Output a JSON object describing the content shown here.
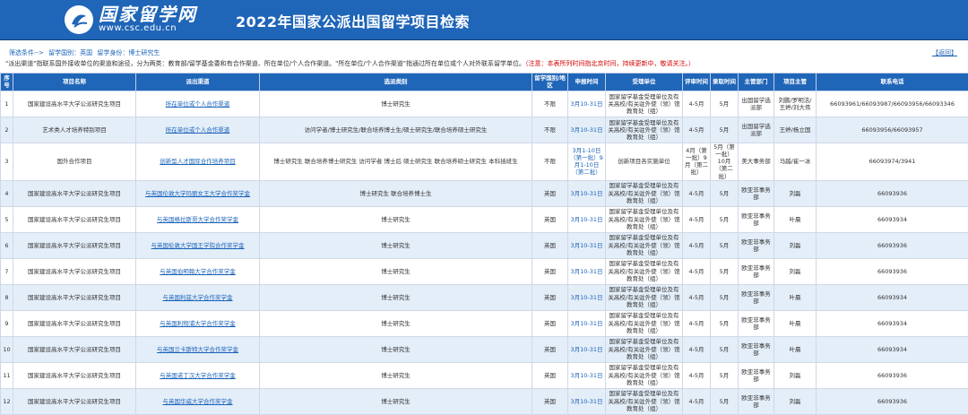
{
  "header": {
    "logo_title": "国家留学网",
    "logo_url": "www.csc.edu.cn",
    "page_title": "2022年国家公派出国留学项目检索"
  },
  "filter": {
    "label": "筛选条件-->",
    "country": "留学国别：英国",
    "identity": "留学身份：博士研究生",
    "back_label": "【返回】"
  },
  "note": {
    "text": "\"派出渠道\"指联系国外接收单位的渠道和途径，分为两类：教育部/留学基金委和有合作渠道、所在单位/个人合作渠道。\"所在单位/个人合作渠道\"指通过所在单位或个人对外联系留学单位。",
    "warning": "（注意：本表所列时间指北京时间，持续更新中，敬请关注。）"
  },
  "table": {
    "headers": [
      "序号",
      "项目名称",
      "派出渠道",
      "选派类别",
      "留学国别/地区",
      "申报时间",
      "受理单位",
      "评审时间",
      "录取时间",
      "主管部门",
      "项目主管",
      "联系电话"
    ],
    "rows": [
      {
        "no": "1",
        "name": "国家建设高水平大学公派研究生项目",
        "channel": "所在单位或个人合作渠道",
        "category": "博士研究生",
        "country": "不限",
        "apply": "3月10-31日",
        "accept": "国家留学基金受理单位及有关高校/有关驻外使（领）馆教育处（组）",
        "review": "4-5月",
        "admit": "5月",
        "dept": "出国留学选派部",
        "manager": "刘鹏/罗明洁/王婷/刘大伟",
        "phone": "66093961/66093987/66093956/66093346"
      },
      {
        "no": "2",
        "name": "艺术类人才培养特别项目",
        "channel": "所在单位或个人合作渠道",
        "category": "访问学者/博士研究生/联合培养博士生/硕士研究生/联合培养硕士研究生",
        "country": "不限",
        "apply": "3月10-31日",
        "accept": "国家留学基金受理单位及有关高校/有关驻外使（领）馆教育处（组）",
        "review": "4-5月",
        "admit": "5月",
        "dept": "出国留学选派部",
        "manager": "王婷/杨立国",
        "phone": "66093956/66093957"
      },
      {
        "no": "3",
        "name": "国外合作项目",
        "channel": "创新型人才国际合作培养项目",
        "category": "博士研究生 联合培养博士研究生 访问学者 博士后 硕士研究生 联合培养硕士研究生 本科插班生",
        "country": "不限",
        "apply": "3月1-10日（第一批）9月1-10日（第二批）",
        "accept": "创新项目各实施单位",
        "review": "4月（第一批）9月（第二批）",
        "admit": "5月（第一批）10月（第二批）",
        "dept": "美大事务部",
        "manager": "马越/崔一冰",
        "phone": "66093974/3941"
      },
      {
        "no": "4",
        "name": "国家建设高水平大学公派研究生项目",
        "channel": "与英国伦敦大学玛丽女王大学合作奖学金",
        "category": "博士研究生 联合培养博士生",
        "country": "英国",
        "apply": "3月10-31日",
        "accept": "国家留学基金受理单位及有关高校/有关驻外使（领）馆教育处（组）",
        "review": "4-5月",
        "admit": "5月",
        "dept": "欧亚非事务部",
        "manager": "刘磊",
        "phone": "66093936"
      },
      {
        "no": "5",
        "name": "国家建设高水平大学公派研究生项目",
        "channel": "与英国格拉斯哥大学合作奖学金",
        "category": "博士研究生",
        "country": "英国",
        "apply": "3月10-31日",
        "accept": "国家留学基金受理单位及有关高校/有关驻外使（领）馆教育处（组）",
        "review": "4-5月",
        "admit": "5月",
        "dept": "欧亚非事务部",
        "manager": "叶晨",
        "phone": "66093934"
      },
      {
        "no": "6",
        "name": "国家建设高水平大学公派研究生项目",
        "channel": "与英国伦敦大学国王学院合作奖学金",
        "category": "博士研究生",
        "country": "英国",
        "apply": "3月10-31日",
        "accept": "国家留学基金受理单位及有关高校/有关驻外使（领）馆教育处（组）",
        "review": "4-5月",
        "admit": "5月",
        "dept": "欧亚非事务部",
        "manager": "刘磊",
        "phone": "66093936"
      },
      {
        "no": "7",
        "name": "国家建设高水平大学公派研究生项目",
        "channel": "与英国伯明翰大学合作奖学金",
        "category": "博士研究生",
        "country": "英国",
        "apply": "3月10-31日",
        "accept": "国家留学基金受理单位及有关高校/有关驻外使（领）馆教育处（组）",
        "review": "4-5月",
        "admit": "5月",
        "dept": "欧亚非事务部",
        "manager": "刘磊",
        "phone": "66093936"
      },
      {
        "no": "8",
        "name": "国家建设高水平大学公派研究生项目",
        "channel": "与英国利兹大学合作奖学金",
        "category": "博士研究生",
        "country": "英国",
        "apply": "3月10-31日",
        "accept": "国家留学基金受理单位及有关高校/有关驻外使（领）馆教育处（组）",
        "review": "4-5月",
        "admit": "5月",
        "dept": "欧亚非事务部",
        "manager": "叶晨",
        "phone": "66093934"
      },
      {
        "no": "9",
        "name": "国家建设高水平大学公派研究生项目",
        "channel": "与英国利物浦大学合作奖学金",
        "category": "博士研究生",
        "country": "英国",
        "apply": "3月10-31日",
        "accept": "国家留学基金受理单位及有关高校/有关驻外使（领）馆教育处（组）",
        "review": "4-5月",
        "admit": "5月",
        "dept": "欧亚非事务部",
        "manager": "叶晨",
        "phone": "66093934"
      },
      {
        "no": "10",
        "name": "国家建设高水平大学公派研究生项目",
        "channel": "与英国兰卡斯特大学合作奖学金",
        "category": "博士研究生",
        "country": "英国",
        "apply": "3月10-31日",
        "accept": "国家留学基金受理单位及有关高校/有关驻外使（领）馆教育处（组）",
        "review": "4-5月",
        "admit": "5月",
        "dept": "欧亚非事务部",
        "manager": "叶晨",
        "phone": "66093934"
      },
      {
        "no": "11",
        "name": "国家建设高水平大学公派研究生项目",
        "channel": "与英国诺丁汉大学合作奖学金",
        "category": "博士研究生",
        "country": "英国",
        "apply": "3月10-31日",
        "accept": "国家留学基金受理单位及有关高校/有关驻外使（领）馆教育处（组）",
        "review": "4-5月",
        "admit": "5月",
        "dept": "欧亚非事务部",
        "manager": "刘磊",
        "phone": "66093936"
      },
      {
        "no": "12",
        "name": "国家建设高水平大学公派研究生项目",
        "channel": "与英国华威大学合作奖学金",
        "category": "博士研究生",
        "country": "英国",
        "apply": "3月10-31日",
        "accept": "国家留学基金受理单位及有关高校/有关驻外使（领）馆教育处（组）",
        "review": "4-5月",
        "admit": "5月",
        "dept": "欧亚非事务部",
        "manager": "刘磊",
        "phone": "66093936"
      }
    ]
  },
  "colors": {
    "header_bg": "#1f65b8",
    "link": "#1a63b8",
    "warning": "#d60000",
    "row_alt": "#e4eef9"
  }
}
